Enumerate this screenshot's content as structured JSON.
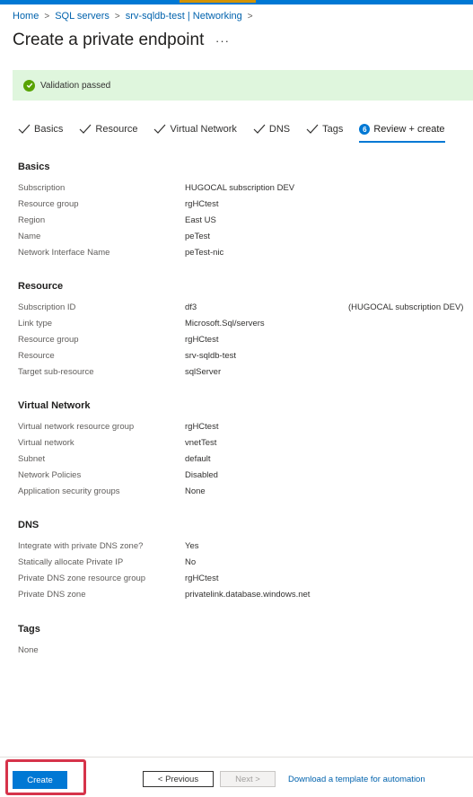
{
  "breadcrumb": {
    "items": [
      "Home",
      "SQL servers",
      "srv-sqldb-test | Networking"
    ]
  },
  "page": {
    "title": "Create a private endpoint",
    "more": "···"
  },
  "validation": {
    "text": "Validation passed",
    "color": "#57a300"
  },
  "tabs": [
    {
      "label": "Basics",
      "state": "completed"
    },
    {
      "label": "Resource",
      "state": "completed"
    },
    {
      "label": "Virtual Network",
      "state": "completed"
    },
    {
      "label": "DNS",
      "state": "completed"
    },
    {
      "label": "Tags",
      "state": "completed"
    },
    {
      "label": "Review + create",
      "state": "active",
      "step": "6"
    }
  ],
  "sections": {
    "basics": {
      "title": "Basics",
      "rows": [
        {
          "label": "Subscription",
          "value": "HUGOCAL subscription DEV"
        },
        {
          "label": "Resource group",
          "value": "rgHCtest"
        },
        {
          "label": "Region",
          "value": "East US"
        },
        {
          "label": "Name",
          "value": "peTest"
        },
        {
          "label": "Network Interface Name",
          "value": "peTest-nic"
        }
      ]
    },
    "resource": {
      "title": "Resource",
      "rows": [
        {
          "label": "Subscription ID",
          "value": "df3",
          "extra": "(HUGOCAL subscription DEV)"
        },
        {
          "label": "Link type",
          "value": "Microsoft.Sql/servers"
        },
        {
          "label": "Resource group",
          "value": "rgHCtest"
        },
        {
          "label": "Resource",
          "value": "srv-sqldb-test"
        },
        {
          "label": "Target sub-resource",
          "value": "sqlServer"
        }
      ]
    },
    "virtual_network": {
      "title": "Virtual Network",
      "rows": [
        {
          "label": "Virtual network resource group",
          "value": "rgHCtest"
        },
        {
          "label": "Virtual network",
          "value": "vnetTest"
        },
        {
          "label": "Subnet",
          "value": "default"
        },
        {
          "label": "Network Policies",
          "value": "Disabled"
        },
        {
          "label": "Application security groups",
          "value": "None"
        }
      ]
    },
    "dns": {
      "title": "DNS",
      "rows": [
        {
          "label": "Integrate with private DNS zone?",
          "value": "Yes"
        },
        {
          "label": "Statically allocate Private IP",
          "value": "No"
        },
        {
          "label": "Private DNS zone resource group",
          "value": "rgHCtest"
        },
        {
          "label": "Private DNS zone",
          "value": "privatelink.database.windows.net"
        }
      ]
    },
    "tags": {
      "title": "Tags",
      "none_text": "None"
    }
  },
  "footer": {
    "create_label": "Create",
    "previous_label": "< Previous",
    "next_label": "Next >",
    "template_link": "Download a template for automation"
  },
  "colors": {
    "accent": "#0078d4",
    "highlight": "#d6334a"
  }
}
